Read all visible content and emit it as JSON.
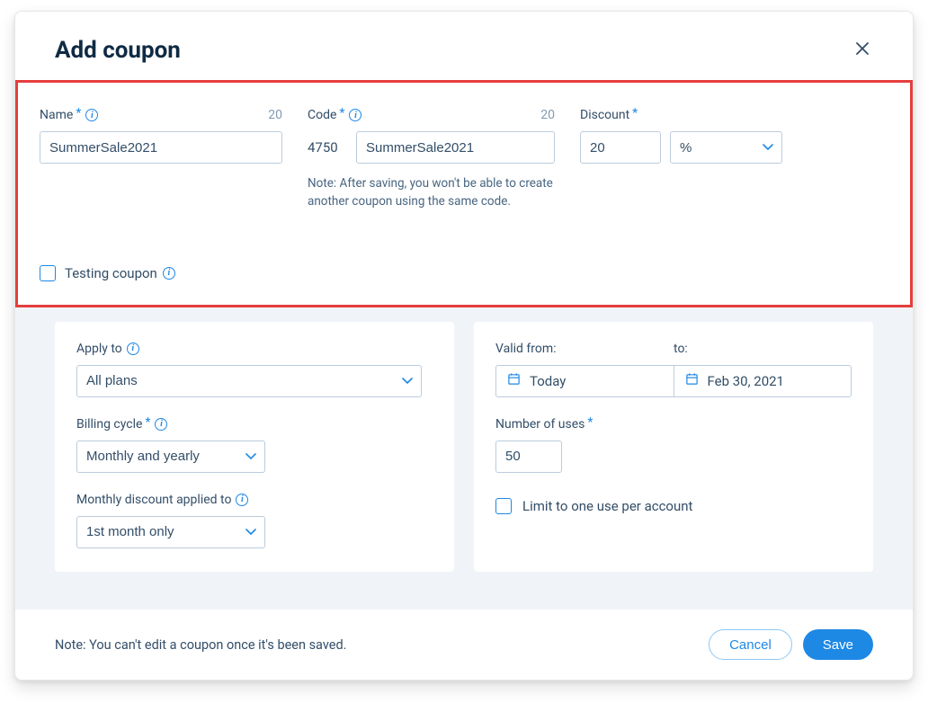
{
  "header": {
    "title": "Add coupon"
  },
  "top": {
    "name_label": "Name",
    "name_count": "20",
    "name_value": "SummerSale2021",
    "code_label": "Code",
    "code_count": "20",
    "code_prefix": "4750",
    "code_value": "SummerSale2021",
    "code_note": "Note: After saving, you won't be able to create another coupon using the same code.",
    "discount_label": "Discount",
    "discount_value": "20",
    "discount_unit": "%",
    "testing_label": "Testing coupon"
  },
  "left": {
    "apply_label": "Apply to",
    "apply_value": "All plans",
    "billing_label": "Billing cycle",
    "billing_value": "Monthly and yearly",
    "monthly_label": "Monthly discount applied to",
    "monthly_value": "1st month only"
  },
  "right": {
    "valid_from_label": "Valid from:",
    "valid_to_label": "to:",
    "valid_from_value": "Today",
    "valid_to_value": "Feb 30, 2021",
    "uses_label": "Number of uses",
    "uses_value": "50",
    "limit_label": "Limit to one use per account"
  },
  "footer": {
    "note": "Note: You can't edit a coupon once it's been saved.",
    "cancel": "Cancel",
    "save": "Save"
  }
}
